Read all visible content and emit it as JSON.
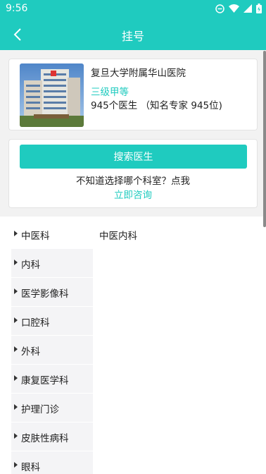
{
  "status_bar": {
    "time": "9:56"
  },
  "header": {
    "title": "挂号",
    "back_icon": "chevron-left-icon"
  },
  "hospital": {
    "name": "复旦大学附属华山医院",
    "level": "三级甲等",
    "doctor_summary": "945个医生 （知名专家 945位)"
  },
  "search": {
    "button_label": "搜索医生",
    "help_text": "不知道选择哪个科室？点我",
    "consult_link": "立即咨询"
  },
  "departments": {
    "items": [
      {
        "label": "中医科",
        "selected": true
      },
      {
        "label": "内科"
      },
      {
        "label": "医学影像科"
      },
      {
        "label": "口腔科"
      },
      {
        "label": "外科"
      },
      {
        "label": "康复医学科"
      },
      {
        "label": "护理门诊"
      },
      {
        "label": "皮肤性病科"
      },
      {
        "label": "眼科"
      }
    ],
    "sub_items": [
      "中医内科"
    ]
  },
  "colors": {
    "accent": "#1fcbbf"
  }
}
